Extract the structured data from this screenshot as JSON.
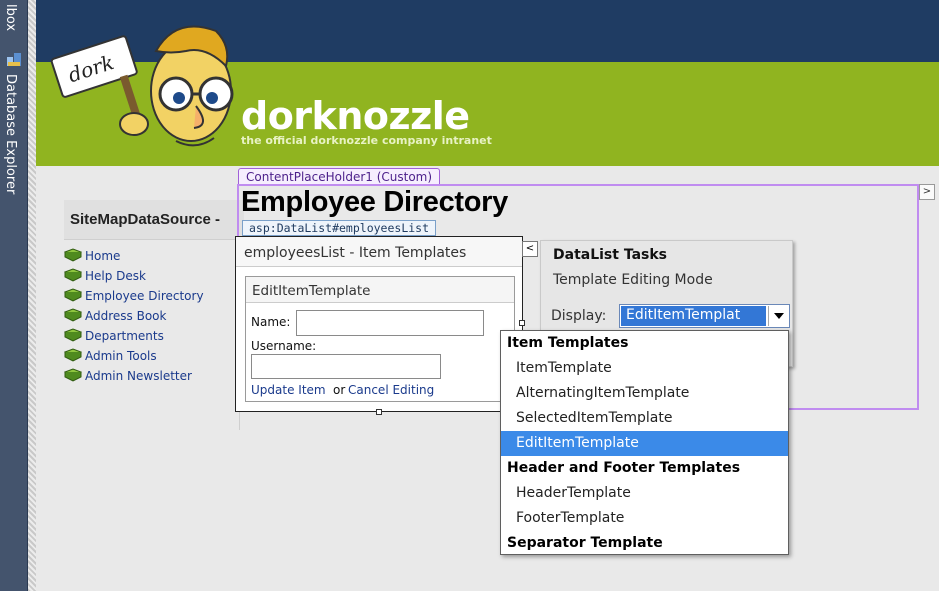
{
  "toolbox": {
    "tab1": "lbox",
    "tab2": "Database Explorer"
  },
  "site": {
    "logo_text": "dork",
    "brand": "dorknozzle",
    "tagline": "the official dorknozzle company intranet"
  },
  "left_nav": {
    "datasource_label": "SiteMapDataSource - ",
    "items": [
      "Home",
      "Help Desk",
      "Employee Directory",
      "Address Book",
      "Departments",
      "Admin Tools",
      "Admin Newsletter"
    ]
  },
  "content": {
    "placeholder_tab": "ContentPlaceHolder1 (Custom)",
    "heading": "Employee Directory",
    "datalist_tab": "asp:DataList#employeesList",
    "datalist_header": "employeesList - Item Templates",
    "edit_template_title": "EditItemTemplate",
    "name_label": "Name:",
    "username_label": "Username:",
    "update_link": "Update Item",
    "or_text": "or ",
    "cancel_link": "Cancel Editing"
  },
  "tasks_panel": {
    "title": "DataList Tasks",
    "mode": "Template Editing Mode",
    "display_label": "Display:",
    "display_value": "EditItemTemplat"
  },
  "dropdown": {
    "groups": [
      {
        "title": "Item Templates",
        "options": [
          "ItemTemplate",
          "AlternatingItemTemplate",
          "SelectedItemTemplate",
          "EditItemTemplate"
        ]
      },
      {
        "title": "Header and Footer Templates",
        "options": [
          "HeaderTemplate",
          "FooterTemplate"
        ]
      },
      {
        "title": "Separator Template",
        "options": []
      }
    ],
    "selected": "EditItemTemplate"
  },
  "colors": {
    "header_navy": "#1f3c63",
    "brand_green": "#90b420",
    "placeholder_border": "#c08cf0",
    "selection_blue": "#3b8ae8"
  }
}
